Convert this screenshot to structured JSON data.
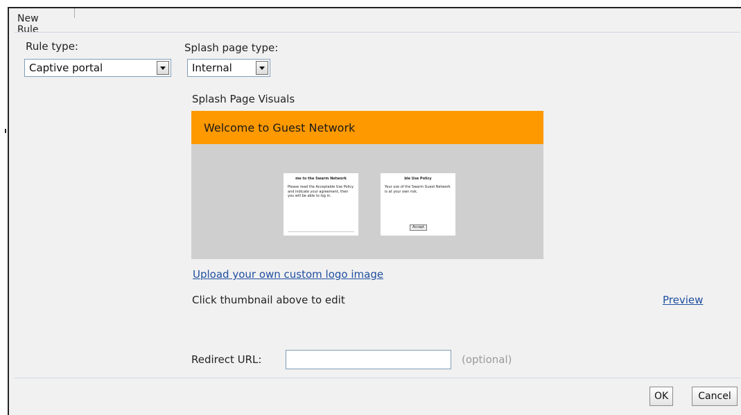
{
  "dialog": {
    "title": "New Rule",
    "rule_type": {
      "label": "Rule type:",
      "selected": "Captive portal"
    },
    "splash_page_type": {
      "label": "Splash page type:",
      "selected": "Internal"
    },
    "splash_visuals": {
      "heading": "Splash Page Visuals",
      "banner_title": "Welcome to Guest Network",
      "banner_color": "#ff9900",
      "background_color": "#cfcfcf",
      "card_left": {
        "title": "me to the Swarm Network",
        "body": "Please read the Acceptable Use Policy and indicate your agreement, then you will be able to log in."
      },
      "card_right": {
        "title": "ble Use Policy",
        "body": "Your use of the Swarm Guest Network is at your own risk.",
        "button": "Accept"
      }
    },
    "upload_logo_link": "Upload your own custom logo image",
    "edit_hint": "Click thumbnail above to edit",
    "preview_link": "Preview",
    "redirect_url": {
      "label": "Redirect URL:",
      "value": "",
      "hint": "(optional)"
    },
    "buttons": {
      "ok": "OK",
      "cancel": "Cancel"
    }
  }
}
